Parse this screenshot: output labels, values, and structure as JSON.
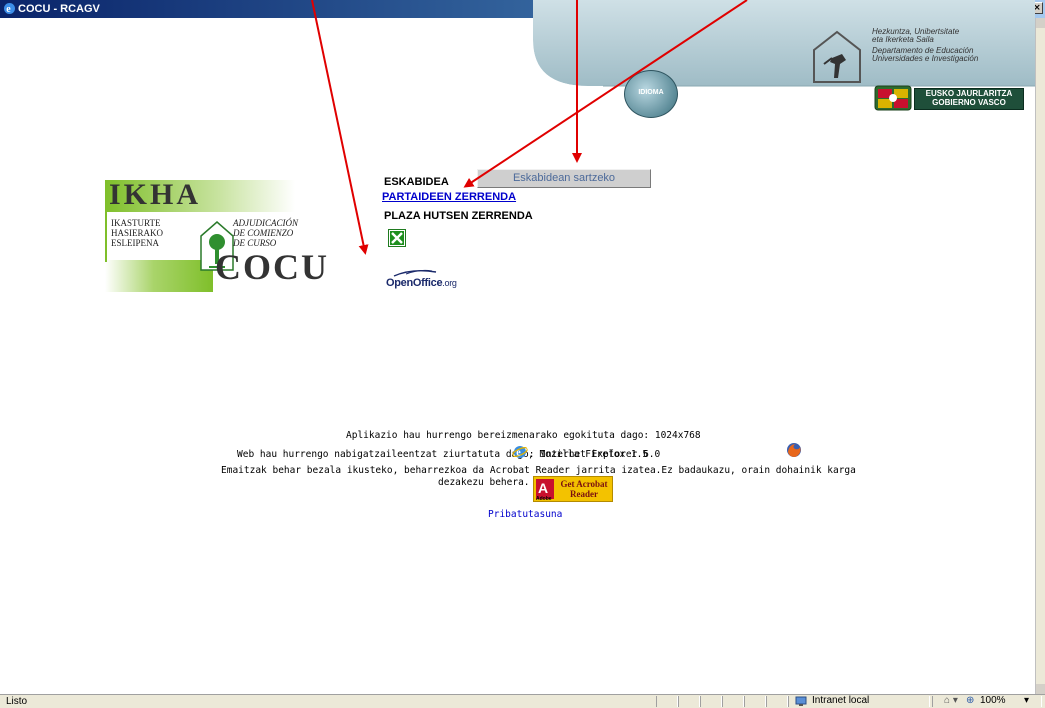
{
  "window": {
    "title": "COCU - RCAGV",
    "controls": [
      "_",
      "□",
      "×"
    ]
  },
  "header": {
    "idioma_label": "IDIOMA",
    "dept_lines": [
      "Hezkuntza, Unibertsitate",
      "eta Ikerketa Saila",
      "Departamento de Educación",
      "Universidades e Investigación"
    ],
    "gov_line1": "EUSKO JAURLARITZA",
    "gov_line2": "GOBIERNO VASCO"
  },
  "logo": {
    "ikha": "IKHA",
    "cocu": "COCU",
    "left_lines": [
      "IKASTURTE",
      "HASIERAKO",
      "ESLEIPENA"
    ],
    "right_lines": [
      "ADJUDICACIÓN",
      "DE COMIENZO",
      "DE CURSO"
    ]
  },
  "menu": {
    "eskabidea_label": "ESKABIDEA",
    "eskabidea_button": "Eskabidean sartzeko",
    "partaideen_link": "PARTAIDEEN ZERRENDA",
    "plaza_label": "PLAZA HUTSEN ZERRENDA",
    "openoffice": "OpenOffice",
    "openoffice_org": ".org"
  },
  "footer": {
    "resolution_text": "Aplikazio hau hurrengo bereizmenarako egokituta dago: 1024x768",
    "browsers_prefix": "Web hau hurrengo nabigatzaileentzat ziurtatuta dago:  Internet Explorer 6.0",
    "browsers_sep": ", Mozilla Firefox 1.5",
    "acrobat_line1": "Emaitzak behar bezala ikusteko, beharrezkoa da Acrobat Reader jarrita izatea.Ez badaukazu, orain dohainik karga",
    "acrobat_line2": "dezakezu behera.",
    "acrobat_btn_text": "Get Acrobat Reader",
    "adobe_word": "Adobe",
    "privacy_link": "Pribatutasuna"
  },
  "statusbar": {
    "status": "Listo",
    "zone": "Intranet local",
    "zoom": "100%"
  },
  "colors": {
    "annotation_arrow": "#e00000",
    "link": "#0000cc",
    "logo_green": "#8dc63f",
    "banner_blue": "#a9c6cf"
  }
}
